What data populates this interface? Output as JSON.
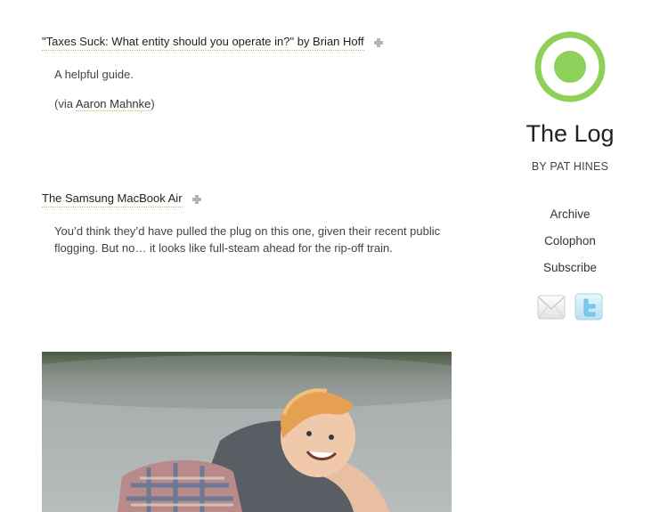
{
  "posts": [
    {
      "title": "\"Taxes Suck: What entity should you operate in?\" by Brian Hoff",
      "body": "A helpful guide.",
      "via_prefix": "(via ",
      "via_link": "Aaron Mahnke",
      "via_suffix": ")"
    },
    {
      "title": "The Samsung MacBook Air",
      "body": "You’d think they’d have pulled the plug on this one, given their recent public flogging. But no… it looks like full-steam ahead for the rip-off train."
    }
  ],
  "sidebar": {
    "site_title": "The Log",
    "byline": "BY PAT HINES",
    "nav": [
      {
        "label": "Archive"
      },
      {
        "label": "Colophon"
      },
      {
        "label": "Subscribe"
      }
    ]
  },
  "icons": {
    "permalink": "plus-icon",
    "logo": "green-ring-logo",
    "mail": "envelope-icon",
    "twitter": "twitter-bird-icon"
  },
  "colors": {
    "accent": "#8fd05a",
    "link_underline": "#9ed36a",
    "text": "#333333"
  }
}
